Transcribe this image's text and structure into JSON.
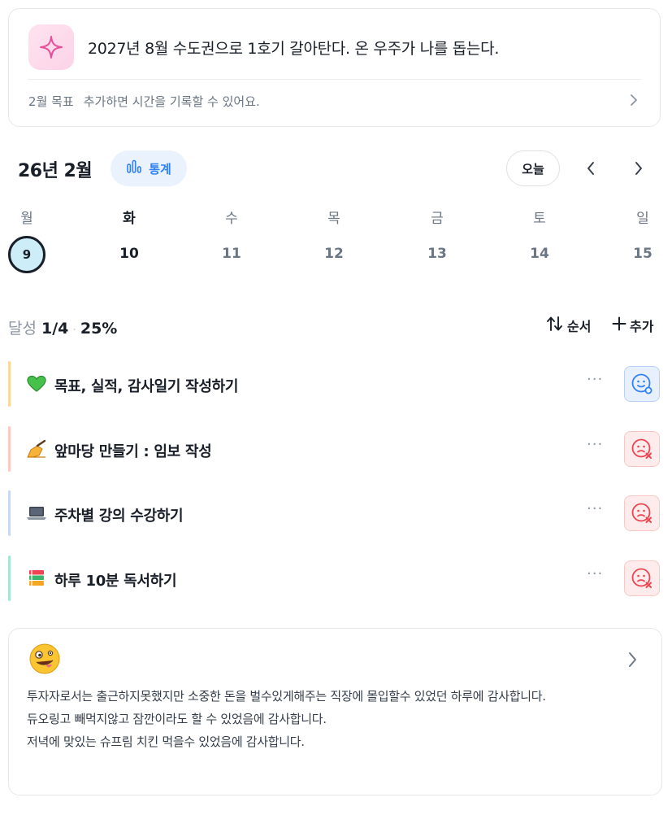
{
  "goal": {
    "title": "2027년 8월 수도권으로 1호기 갈아탄다. 온 우주가 나를 돕는다.",
    "month_label": "2월 목표",
    "hint": "추가하면 시간을 기록할 수 있어요."
  },
  "calendar": {
    "month_title": "26년 2월",
    "stats_label": "통계",
    "today_label": "오늘",
    "weekdays": [
      "월",
      "화",
      "수",
      "목",
      "금",
      "토",
      "일"
    ],
    "days": [
      "9",
      "10",
      "11",
      "12",
      "13",
      "14",
      "15"
    ]
  },
  "summary": {
    "achieve_label": "달성",
    "achieve_count": "1/4",
    "separator": "·",
    "achieve_percent": "25%",
    "order_label": "순서",
    "add_label": "추가"
  },
  "tasks": [
    {
      "label": "목표, 실적, 감사일기 작성하기",
      "icon": "green-heart-icon",
      "status": "done"
    },
    {
      "label": "앞마당 만들기 : 임보 작성",
      "icon": "writing-hand-icon",
      "status": "not-done"
    },
    {
      "label": "주차별 강의 수강하기",
      "icon": "laptop-icon",
      "status": "not-done"
    },
    {
      "label": "하루 10분 독서하기",
      "icon": "books-icon",
      "status": "not-done"
    }
  ],
  "more_label": "···",
  "diary": {
    "icon": "zany-face-icon",
    "lines": [
      "투자자로서는 출근하지못했지만 소중한 돈을 벌수있게해주는 직장에 몰입할수 있었던 하루에 감사합니다.",
      "듀오링고 빼먹지않고 잠깐이라도 할 수 있었음에 감사합니다.",
      "저녁에 맞있는 슈프림 치킨 먹을수 있었음에 감사합니다."
    ]
  },
  "colors": {
    "accent": "#3182f6",
    "selected_day_bg": "#cdeef8",
    "bar_1": "#ffd79a",
    "bar_2": "#ffc9c3",
    "bar_3": "#c8d8f3",
    "bar_4": "#a8e6d0"
  }
}
